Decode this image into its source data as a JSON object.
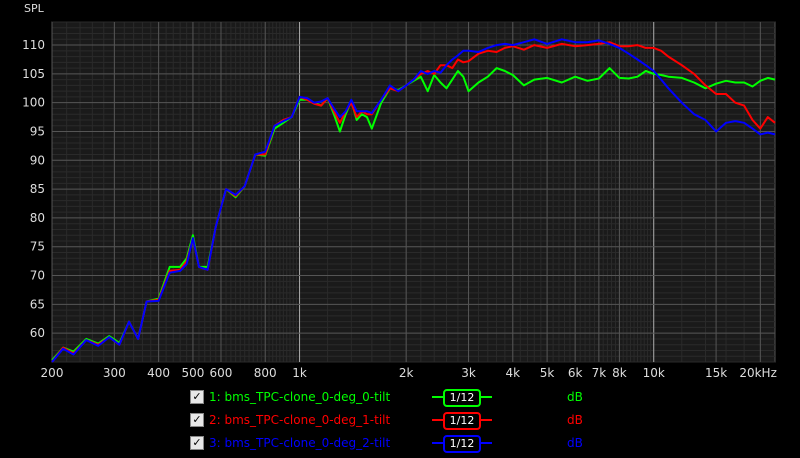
{
  "chart_data": {
    "type": "line",
    "ylabel": "SPL",
    "x_scale": "log",
    "xlim": [
      200,
      22000
    ],
    "ylim": [
      55,
      114
    ],
    "grid": true,
    "x_ticks": [
      {
        "value": 200,
        "label": "200"
      },
      {
        "value": 300,
        "label": "300"
      },
      {
        "value": 400,
        "label": "400"
      },
      {
        "value": 500,
        "label": "500"
      },
      {
        "value": 600,
        "label": "600"
      },
      {
        "value": 800,
        "label": "800"
      },
      {
        "value": 1000,
        "label": "1k"
      },
      {
        "value": 2000,
        "label": "2k"
      },
      {
        "value": 3000,
        "label": "3k"
      },
      {
        "value": 4000,
        "label": "4k"
      },
      {
        "value": 5000,
        "label": "5k"
      },
      {
        "value": 6000,
        "label": "6k"
      },
      {
        "value": 7000,
        "label": "7k"
      },
      {
        "value": 8000,
        "label": "8k"
      },
      {
        "value": 10000,
        "label": "10k"
      },
      {
        "value": 15000,
        "label": "15k"
      },
      {
        "value": 20000,
        "label": "20kHz"
      }
    ],
    "y_ticks": [
      60,
      65,
      70,
      75,
      80,
      85,
      90,
      95,
      100,
      105,
      110
    ],
    "series": [
      {
        "name": "1: bms_TPC-clone_0-deg_0-tilt",
        "color": "#00ff00",
        "x": [
          200,
          215,
          230,
          250,
          270,
          290,
          310,
          330,
          350,
          370,
          400,
          430,
          460,
          480,
          500,
          520,
          550,
          580,
          620,
          660,
          700,
          750,
          800,
          850,
          900,
          950,
          1000,
          1050,
          1100,
          1150,
          1200,
          1250,
          1300,
          1350,
          1400,
          1450,
          1500,
          1550,
          1600,
          1700,
          1800,
          1900,
          2000,
          2100,
          2200,
          2300,
          2400,
          2500,
          2600,
          2700,
          2800,
          2900,
          3000,
          3200,
          3400,
          3600,
          3800,
          4000,
          4300,
          4600,
          5000,
          5500,
          6000,
          6500,
          7000,
          7500,
          8000,
          8500,
          9000,
          9500,
          10000,
          10500,
          11000,
          12000,
          13000,
          14000,
          15000,
          16000,
          17000,
          18000,
          19000,
          20000,
          21000,
          22000
        ],
        "y": [
          55.3,
          57.5,
          56.8,
          59,
          58.2,
          59.5,
          58.3,
          62,
          59,
          65.5,
          66,
          71.5,
          71.5,
          73,
          77,
          71.5,
          71.5,
          78.5,
          85,
          83.6,
          85.5,
          91,
          90.8,
          95.5,
          96.5,
          97.5,
          100.5,
          100.5,
          100,
          99.5,
          100.8,
          98,
          95,
          98,
          100.3,
          97,
          98,
          97.5,
          95.5,
          100,
          102.5,
          102.2,
          103,
          103.8,
          104.5,
          102,
          104.8,
          103.5,
          102.5,
          104,
          105.5,
          104.5,
          102,
          103.5,
          104.5,
          106,
          105.5,
          104.8,
          103,
          104,
          104.3,
          103.5,
          104.5,
          103.8,
          104.2,
          106,
          104.3,
          104.2,
          104.5,
          105.5,
          105,
          104.8,
          104.5,
          104.3,
          103.5,
          102.5,
          103.3,
          103.8,
          103.5,
          103.5,
          102.8,
          103.8,
          104.3,
          104
        ]
      },
      {
        "name": "2: bms_TPC-clone_0-deg_1-tilt",
        "color": "#ff0000",
        "x": [
          200,
          215,
          230,
          250,
          270,
          290,
          310,
          330,
          350,
          370,
          400,
          430,
          460,
          480,
          500,
          520,
          550,
          580,
          620,
          660,
          700,
          750,
          800,
          850,
          900,
          950,
          1000,
          1050,
          1100,
          1150,
          1200,
          1250,
          1300,
          1350,
          1400,
          1450,
          1500,
          1550,
          1600,
          1700,
          1800,
          1900,
          2000,
          2100,
          2200,
          2300,
          2400,
          2500,
          2600,
          2700,
          2800,
          2900,
          3000,
          3200,
          3400,
          3600,
          3800,
          4000,
          4300,
          4600,
          5000,
          5500,
          6000,
          6500,
          7000,
          7500,
          8000,
          8500,
          9000,
          9500,
          10000,
          10500,
          11000,
          12000,
          13000,
          14000,
          15000,
          16000,
          17000,
          18000,
          19000,
          20000,
          21000,
          22000
        ],
        "y": [
          55,
          57.5,
          56.5,
          58.8,
          58,
          59.3,
          58,
          62,
          59,
          65.5,
          65.8,
          70.8,
          71,
          72.5,
          76.5,
          71.5,
          71,
          78.5,
          85,
          83.8,
          85.5,
          91,
          91,
          96,
          97,
          97.5,
          101,
          100.5,
          99.8,
          99.5,
          100.8,
          98.5,
          96.5,
          98.5,
          100,
          97.5,
          98.5,
          98,
          98,
          100.5,
          102.5,
          102,
          103,
          104,
          105,
          105.5,
          105,
          106.5,
          106.5,
          106,
          107.5,
          107,
          107.2,
          108.5,
          109,
          108.8,
          109.5,
          109.8,
          109.2,
          110,
          109.5,
          110.2,
          109.8,
          110,
          110.2,
          110.5,
          109.8,
          109.8,
          110,
          109.5,
          109.5,
          109,
          108,
          106.5,
          105,
          103,
          101.5,
          101.5,
          100,
          99.5,
          97,
          95.5,
          97.5,
          96.5
        ]
      },
      {
        "name": "3: bms_TPC-clone_0-deg_2-tilt",
        "color": "#0000ff",
        "x": [
          200,
          215,
          230,
          250,
          270,
          290,
          310,
          330,
          350,
          370,
          400,
          430,
          460,
          480,
          500,
          520,
          550,
          580,
          620,
          660,
          700,
          750,
          800,
          850,
          900,
          950,
          1000,
          1050,
          1100,
          1150,
          1200,
          1250,
          1300,
          1350,
          1400,
          1450,
          1500,
          1550,
          1600,
          1700,
          1800,
          1900,
          2000,
          2100,
          2200,
          2300,
          2400,
          2500,
          2600,
          2700,
          2800,
          2900,
          3000,
          3200,
          3400,
          3600,
          3800,
          4000,
          4300,
          4600,
          5000,
          5500,
          6000,
          6500,
          7000,
          7500,
          8000,
          8500,
          9000,
          9500,
          10000,
          10500,
          11000,
          12000,
          13000,
          14000,
          15000,
          16000,
          17000,
          18000,
          19000,
          20000,
          21000,
          22000
        ],
        "y": [
          55,
          57.3,
          56.3,
          58.8,
          57.8,
          59.3,
          58,
          62,
          59,
          65.5,
          65.6,
          70.5,
          70.8,
          72,
          76.5,
          71.5,
          71,
          78.5,
          85,
          84,
          85.5,
          91,
          91.5,
          96,
          96.8,
          97.5,
          101,
          100.8,
          100,
          100.2,
          100.8,
          99,
          97.5,
          98.5,
          100.5,
          98.5,
          98.5,
          98.5,
          98.2,
          100.5,
          103,
          102,
          103,
          104,
          105.5,
          105,
          105.5,
          105.2,
          106.5,
          107.5,
          108.2,
          109,
          109,
          108.8,
          109.5,
          110,
          110.2,
          110,
          110.5,
          111,
          110.2,
          111,
          110.5,
          110.5,
          110.8,
          110.2,
          109.5,
          108.5,
          107.5,
          106.5,
          105.5,
          104,
          102.5,
          100,
          98,
          97,
          95,
          96.5,
          96.8,
          96.5,
          95.5,
          94.5,
          94.8,
          94.5
        ]
      }
    ]
  },
  "legend": [
    {
      "check": "✓",
      "label": "1: bms_TPC-clone_0-deg_0-tilt",
      "smoothing": "1/12",
      "unit": "dB",
      "color": "#00ff00"
    },
    {
      "check": "✓",
      "label": "2: bms_TPC-clone_0-deg_1-tilt",
      "smoothing": "1/12",
      "unit": "dB",
      "color": "#ff0000"
    },
    {
      "check": "✓",
      "label": "3: bms_TPC-clone_0-deg_2-tilt",
      "smoothing": "1/12",
      "unit": "dB",
      "color": "#0000ff"
    }
  ]
}
